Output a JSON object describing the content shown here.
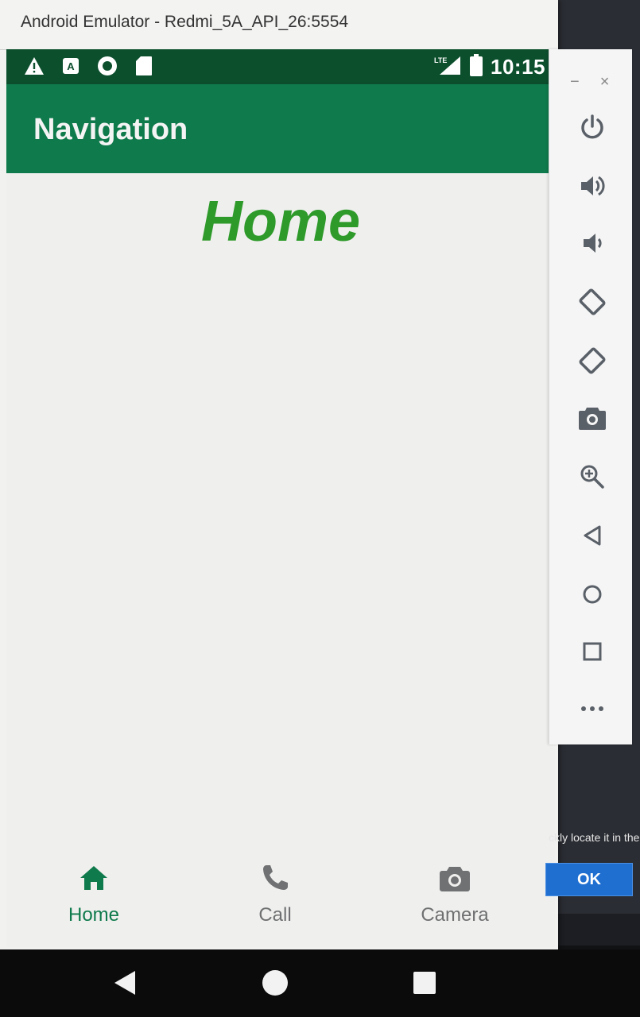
{
  "window": {
    "title": "Android Emulator - Redmi_5A_API_26:5554"
  },
  "status_bar": {
    "left_icons": [
      "warning-icon",
      "a-notification-icon",
      "record-icon",
      "sd-card-icon"
    ],
    "network": "LTE",
    "time": "10:15",
    "color": "#0c4f2d"
  },
  "app_bar": {
    "title": "Navigation",
    "color": "#0f7a4b"
  },
  "content": {
    "heading": "Home",
    "heading_color": "#2e9a2a"
  },
  "bottom_nav": {
    "items": [
      {
        "label": "Home",
        "icon": "home-icon",
        "active": true
      },
      {
        "label": "Call",
        "icon": "phone-icon",
        "active": false
      },
      {
        "label": "Camera",
        "icon": "camera-icon",
        "active": false
      }
    ]
  },
  "system_nav": [
    "back-icon",
    "home-circle-icon",
    "recents-square-icon"
  ],
  "toolbar": {
    "window_controls": [
      "−",
      "×"
    ],
    "buttons": [
      "power-icon",
      "volume-up-icon",
      "volume-down-icon",
      "rotate-left-icon",
      "rotate-right-icon",
      "screenshot-icon",
      "zoom-icon",
      "back-icon",
      "home-icon",
      "overview-icon",
      "more-icon"
    ]
  },
  "background_dialog": {
    "hint": "ckly locate it in the",
    "ok_label": "OK"
  }
}
